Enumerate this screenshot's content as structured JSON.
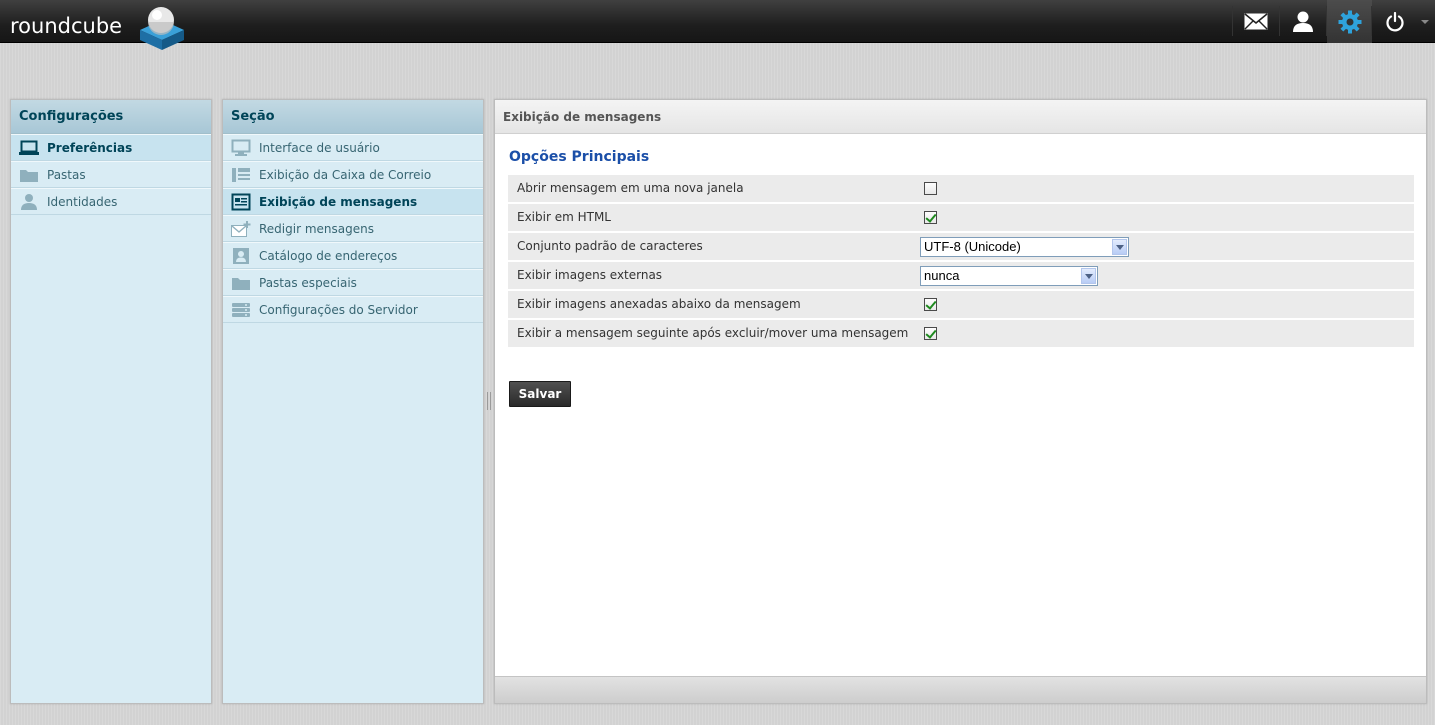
{
  "app": {
    "logo_text": "roundcube"
  },
  "topnav": {
    "items": [
      {
        "icon": "mail-icon"
      },
      {
        "icon": "contacts-icon"
      },
      {
        "icon": "settings-icon",
        "selected": true
      },
      {
        "icon": "logout-icon"
      }
    ]
  },
  "settings_panel": {
    "title": "Configurações",
    "items": [
      {
        "label": "Preferências",
        "icon": "laptop-icon",
        "selected": true
      },
      {
        "label": "Pastas",
        "icon": "folder-icon"
      },
      {
        "label": "Identidades",
        "icon": "user-icon"
      }
    ]
  },
  "sections_panel": {
    "title": "Seção",
    "items": [
      {
        "label": "Interface de usuário",
        "icon": "monitor-icon"
      },
      {
        "label": "Exibição da Caixa de Correio",
        "icon": "mailbox-layout-icon"
      },
      {
        "label": "Exibição de mensagens",
        "icon": "message-view-icon",
        "selected": true
      },
      {
        "label": "Redigir mensagens",
        "icon": "compose-icon"
      },
      {
        "label": "Catálogo de endereços",
        "icon": "addressbook-icon"
      },
      {
        "label": "Pastas especiais",
        "icon": "folder-icon"
      },
      {
        "label": "Configurações do Servidor",
        "icon": "server-icon"
      }
    ]
  },
  "content": {
    "header": "Exibição de mensagens",
    "section_title": "Opções Principais",
    "options": [
      {
        "label": "Abrir mensagem em uma nova janela",
        "type": "checkbox",
        "checked": false
      },
      {
        "label": "Exibir em HTML",
        "type": "checkbox",
        "checked": true
      },
      {
        "label": "Conjunto padrão de caracteres",
        "type": "select",
        "value": "UTF-8 (Unicode)"
      },
      {
        "label": "Exibir imagens externas",
        "type": "select",
        "value": "nunca"
      },
      {
        "label": "Exibir imagens anexadas abaixo da mensagem",
        "type": "checkbox",
        "checked": true
      },
      {
        "label": "Exibir a mensagem seguinte após excluir/mover uma mensagem",
        "type": "checkbox",
        "checked": true
      }
    ],
    "save_label": "Salvar"
  },
  "colors": {
    "accent_blue": "#1b4fa8",
    "panel_bg": "#d9ecf4",
    "topbar_bg": "#1e1e1e"
  }
}
